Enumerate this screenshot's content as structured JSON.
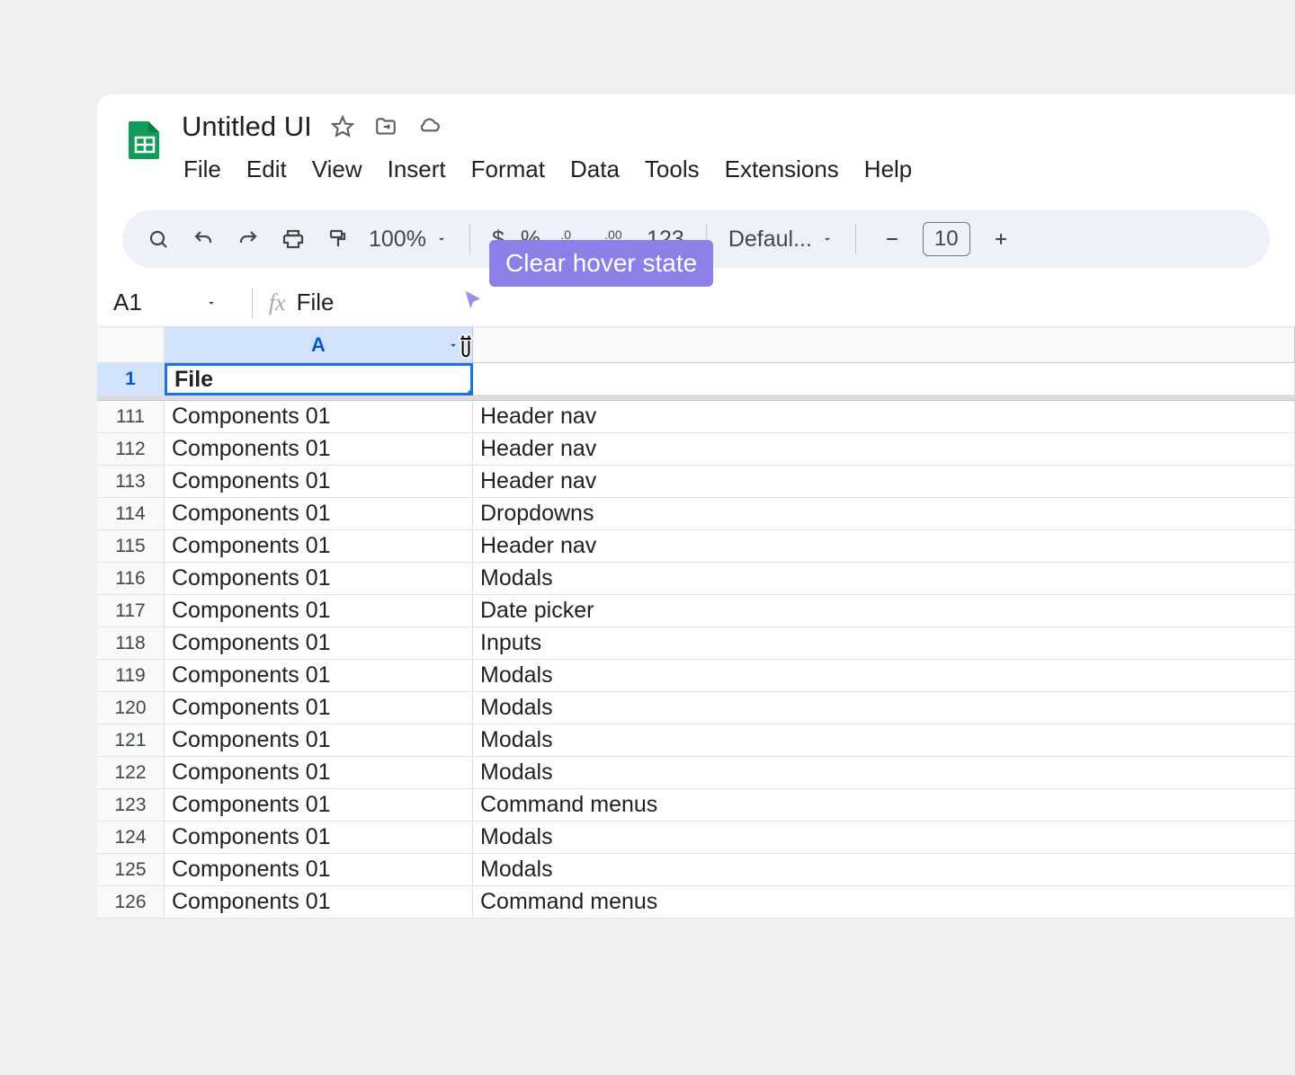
{
  "document": {
    "title": "Untitled UI"
  },
  "menubar": {
    "file": "File",
    "edit": "Edit",
    "view": "View",
    "insert": "Insert",
    "format": "Format",
    "data": "Data",
    "tools": "Tools",
    "extensions": "Extensions",
    "help": "Help"
  },
  "toolbar": {
    "zoom": "100%",
    "currency": "$",
    "percent": "%",
    "number_format": "123",
    "font_name": "Defaul...",
    "font_size": "10"
  },
  "tooltip": "Clear hover state",
  "namebox": {
    "cell_ref": "A1",
    "formula_value": "File"
  },
  "selected_cell": {
    "value": "File"
  },
  "columns": {
    "a": "A"
  },
  "rows": [
    {
      "num": "111",
      "a": "Components 01",
      "b": "Header nav"
    },
    {
      "num": "112",
      "a": "Components 01",
      "b": "Header nav"
    },
    {
      "num": "113",
      "a": "Components 01",
      "b": "Header nav"
    },
    {
      "num": "114",
      "a": "Components 01",
      "b": "Dropdowns"
    },
    {
      "num": "115",
      "a": "Components 01",
      "b": "Header nav"
    },
    {
      "num": "116",
      "a": "Components 01",
      "b": "Modals"
    },
    {
      "num": "117",
      "a": "Components 01",
      "b": "Date picker"
    },
    {
      "num": "118",
      "a": "Components 01",
      "b": "Inputs"
    },
    {
      "num": "119",
      "a": "Components 01",
      "b": "Modals"
    },
    {
      "num": "120",
      "a": "Components 01",
      "b": "Modals"
    },
    {
      "num": "121",
      "a": "Components 01",
      "b": "Modals"
    },
    {
      "num": "122",
      "a": "Components 01",
      "b": "Modals"
    },
    {
      "num": "123",
      "a": "Components 01",
      "b": "Command menus"
    },
    {
      "num": "124",
      "a": "Components 01",
      "b": "Modals"
    },
    {
      "num": "125",
      "a": "Components 01",
      "b": "Modals"
    },
    {
      "num": "126",
      "a": "Components 01",
      "b": "Command menus"
    }
  ],
  "frozen_row_num": "1"
}
